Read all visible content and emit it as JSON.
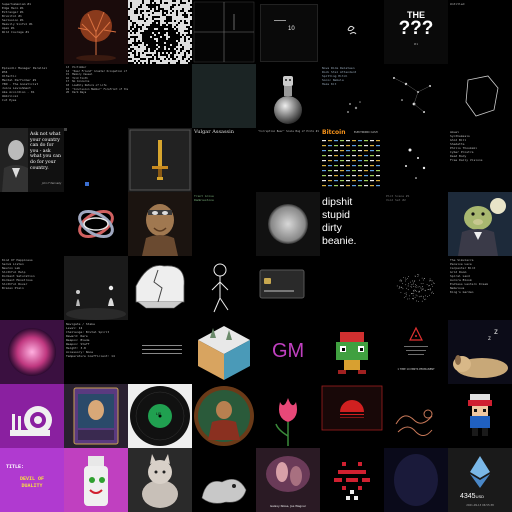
{
  "t_r0c0": {
    "lines": [
      "Superhumanism #1",
      "Edge Hero #1",
      "Extranger #1",
      "Bruxitol #1",
      "Seclusion #1",
      "Heavily Sinful #1",
      "Apex #1",
      "Wild Courage #1"
    ]
  },
  "t_r0c4": {
    "badge": "10"
  },
  "t_r0c6": {
    "title": "THE",
    "big": "???",
    "sub": "#1"
  },
  "t_r0c7": {
    "label": "Untitled"
  },
  "t_r1c0": {
    "lines": [
      "Episodic Manager Parallel",
      "#34",
      "Olfactic",
      "Mental Performer #1",
      "YKN - The Gnosticist",
      "Juice Lavishment",
      "Ake Accordion - 01",
      "Umbilical",
      "Cut Eyes"
    ]
  },
  "t_r1c1": {
    "lines": [
      "13  Pictimber",
      "14  \"Dear Friend\" Greater Occupation of Existence",
      "15  Memory Vessel",
      "16  Told Tooth",
      "17  No Concerns",
      "18  LowPoly Nature of Life",
      "19  \"Conclusion Member\" Forefront of the Por +1",
      "20  Dark Ways"
    ]
  },
  "t_r1c5": {
    "lines": [
      "Nova Ride Relateen",
      "Rock Stal Attendant",
      "Spitting Hitch",
      "Sonic Nebula",
      "Haze Kit"
    ]
  },
  "t_r2c0": {
    "quote": "Ask not what your country can do for you - ask what you can do for your country.",
    "cite": "John F Kennedy"
  },
  "t_r2c3": {
    "title": "Vulgar Assassin"
  },
  "t_r2c4": {
    "title": "\"Corruption Bear\" Scale Bug of Proto #1"
  },
  "t_r2c5": {
    "brand": "Bitcoin",
    "sub": "ELECTRONIC CASH"
  },
  "t_r2c7": {
    "lines": [
      "Amuel",
      "Synthemesis",
      "Ghid Bill",
      "Shadetta",
      "Philis Thoukaki",
      "Cyber Prostra",
      "Dead Body",
      "Free Daily Visions"
    ]
  },
  "t_r3c4": {
    "lines": [
      "dipshit",
      "stupid",
      "dirty",
      "beanie."
    ]
  },
  "t_r3c6": {
    "lines": [
      "Plot Scene #1",
      "Void Set #2"
    ]
  },
  "t_r3c3": {
    "lines": [
      "Trent Grove",
      "Ramblestone"
    ]
  },
  "t_r4c0": {
    "lines": [
      "Kind Of Happiness",
      "Serum Listen",
      "Neuron Lab",
      "Slothful Help",
      "Dormant Saturation",
      "Dormant Monstrous",
      "Slothful Rover",
      "Brazen Plain"
    ]
  },
  "t_r4c7": {
    "lines": [
      "The Simulacra",
      "Pensive Lace",
      "Carpenter Bird",
      "Grid Room",
      "Spiral Land",
      "Aurora Bloom",
      "Endless Lantern Dream",
      "Nebulous",
      "King's Garden"
    ]
  },
  "t_r5c1": {
    "lines": [
      "Navigate / Stake",
      "Level: 12",
      "Challenge: Brutal Spirit",
      "Reward: Rare",
      "Weapon: Blade",
      "Weapon: Staff",
      "Height: 3.8",
      "Accessory: None",
      "Temperature Coefficient: 14"
    ]
  },
  "t_r5c4": {
    "mark": "GM"
  },
  "t_r5c6": {
    "sub": "1 TIME 10 MINTS PERMANENT"
  },
  "t_r6c2": {
    "label": "LP"
  },
  "t_r7c0": {
    "title": "TITLE:",
    "name": "DEVIL OF DUALITY"
  },
  "t_r7c4": {
    "caption": "Galaxy Noise, Joe Wagner"
  },
  "t_r7c7": {
    "price": "4345",
    "unit": "USD",
    "date": "2021-09-13 06:55:38"
  }
}
